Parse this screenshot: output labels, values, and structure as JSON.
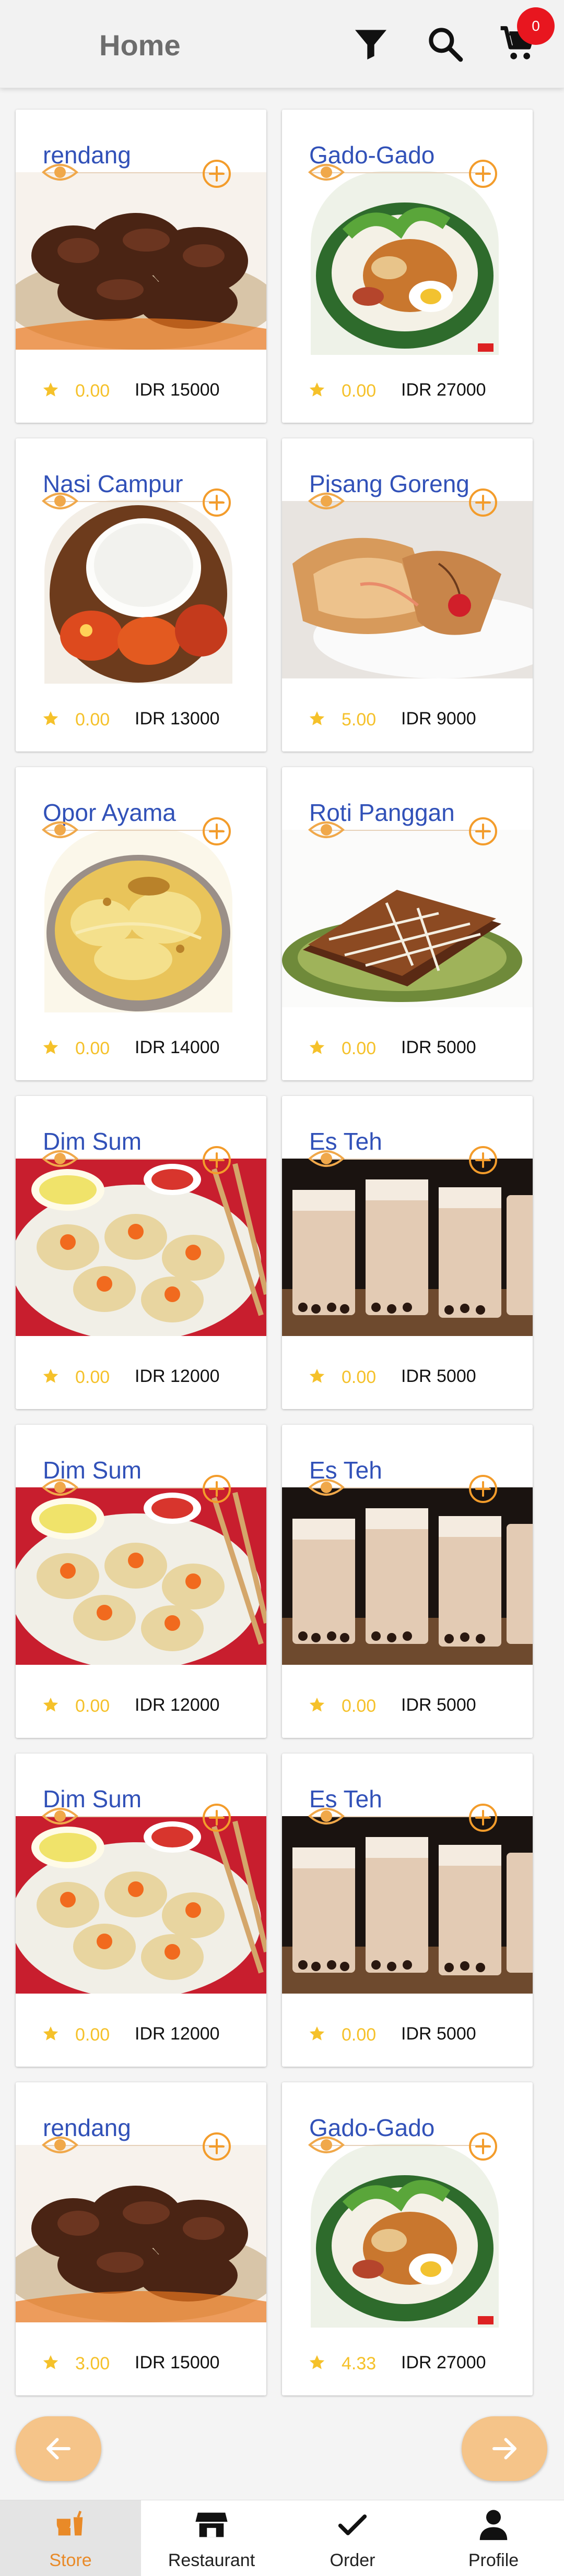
{
  "header": {
    "title": "Home",
    "cart_count": "0",
    "icons": [
      "filter-icon",
      "search-icon",
      "cart-icon"
    ]
  },
  "colors": {
    "accent": "#f39c2b",
    "title": "#3151b8",
    "star": "#f5c12a",
    "badge": "#e8161f"
  },
  "products": [
    {
      "name": "rendang",
      "rating": "0.00",
      "price": "IDR 15000"
    },
    {
      "name": "Gado-Gado",
      "rating": "0.00",
      "price": "IDR 27000"
    },
    {
      "name": "Nasi Campur",
      "rating": "0.00",
      "price": "IDR 13000"
    },
    {
      "name": "Pisang Goreng",
      "rating": "5.00",
      "price": "IDR 9000"
    },
    {
      "name": "Opor Ayama",
      "rating": "0.00",
      "price": "IDR 14000"
    },
    {
      "name": "Roti Panggan",
      "rating": "0.00",
      "price": "IDR 5000"
    },
    {
      "name": "Dim Sum",
      "rating": "0.00",
      "price": "IDR 12000"
    },
    {
      "name": "Es Teh",
      "rating": "0.00",
      "price": "IDR 5000"
    },
    {
      "name": "Dim Sum",
      "rating": "0.00",
      "price": "IDR 12000"
    },
    {
      "name": "Es Teh",
      "rating": "0.00",
      "price": "IDR 5000"
    },
    {
      "name": "Dim Sum",
      "rating": "0.00",
      "price": "IDR 12000"
    },
    {
      "name": "Es Teh",
      "rating": "0.00",
      "price": "IDR 5000"
    },
    {
      "name": "rendang",
      "rating": "3.00",
      "price": "IDR 15000"
    },
    {
      "name": "Gado-Gado",
      "rating": "4.33",
      "price": "IDR 27000"
    }
  ],
  "pagination": {
    "prev_icon": "arrow-left-icon",
    "next_icon": "arrow-right-icon"
  },
  "bottom_nav": [
    {
      "label": "Store",
      "icon": "store-icon"
    },
    {
      "label": "Restaurant",
      "icon": "restaurant-icon"
    },
    {
      "label": "Order",
      "icon": "check-icon"
    },
    {
      "label": "Profile",
      "icon": "profile-icon"
    }
  ]
}
